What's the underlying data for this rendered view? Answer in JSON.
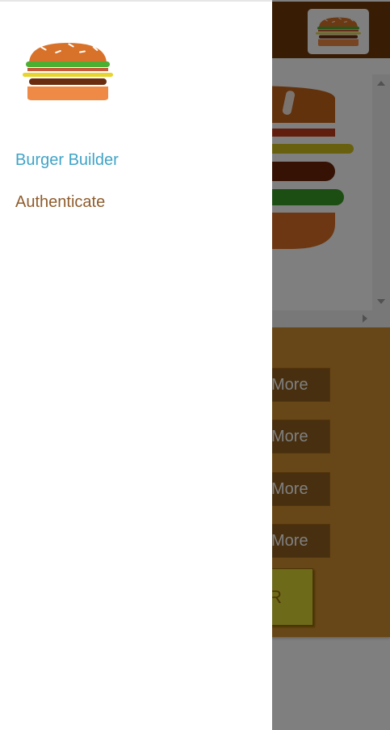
{
  "app": {
    "top_logo_icon": "burger-logo-icon",
    "burger_icon": "burger-icon",
    "controls": {
      "more_buttons": [
        {
          "label": "More"
        },
        {
          "label": "More"
        },
        {
          "label": "More"
        },
        {
          "label": "More"
        }
      ],
      "order_button_label": "R"
    }
  },
  "drawer": {
    "logo_icon": "burger-logo-icon",
    "nav": [
      {
        "label": "Burger Builder",
        "active": true
      },
      {
        "label": "Authenticate",
        "active": false
      }
    ]
  },
  "colors": {
    "toolbar": "#703b09",
    "controls_bg": "#cf8f2e",
    "active_link": "#40a4c8",
    "link": "#8f5c2c",
    "order_button": "#dad735"
  }
}
